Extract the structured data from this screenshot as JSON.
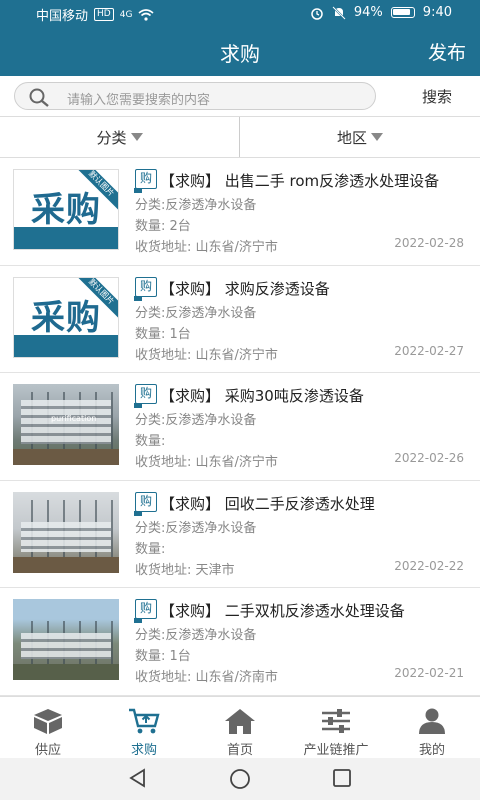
{
  "status": {
    "carrier": "中国移动",
    "hd": "HD",
    "net": "4G",
    "battery": "94%",
    "time": "9:40"
  },
  "header": {
    "title": "求购",
    "publish": "发布"
  },
  "search": {
    "placeholder": "请输入您需要搜索的内容",
    "button": "搜索"
  },
  "filters": [
    {
      "label": "分类"
    },
    {
      "label": "地区"
    }
  ],
  "thumb_text": {
    "logo_main": "采购",
    "logo_ribbon": "默认图片",
    "photo_caption": "purification"
  },
  "items": [
    {
      "tag": "购",
      "title": "【求购】 出售二手 rom反渗透水处理设备",
      "category": "分类:反渗透净水设备",
      "qty": "数量: 2台",
      "addr": "收货地址: 山东省/济宁市",
      "date": "2022-02-28"
    },
    {
      "tag": "购",
      "title": "【求购】 求购反渗透设备",
      "category": "分类:反渗透净水设备",
      "qty": "数量: 1台",
      "addr": "收货地址: 山东省/济宁市",
      "date": "2022-02-27"
    },
    {
      "tag": "购",
      "title": "【求购】 采购30吨反渗透设备",
      "category": "分类:反渗透净水设备",
      "qty": "数量:",
      "addr": "收货地址: 山东省/济宁市",
      "date": "2022-02-26"
    },
    {
      "tag": "购",
      "title": "【求购】 回收二手反渗透水处理",
      "category": "分类:反渗透净水设备",
      "qty": "数量:",
      "addr": "收货地址: 天津市",
      "date": "2022-02-22"
    },
    {
      "tag": "购",
      "title": "【求购】 二手双机反渗透水处理设备",
      "category": "分类:反渗透净水设备",
      "qty": "数量: 1台",
      "addr": "收货地址: 山东省/济南市",
      "date": "2022-02-21"
    }
  ],
  "tabs": [
    {
      "label": "供应",
      "icon": "box-icon"
    },
    {
      "label": "求购",
      "icon": "cart-icon"
    },
    {
      "label": "首页",
      "icon": "home-icon"
    },
    {
      "label": "产业链推广",
      "icon": "sliders-icon"
    },
    {
      "label": "我的",
      "icon": "user-icon"
    }
  ],
  "colors": {
    "brand": "#1f7091",
    "text": "#222222",
    "muted": "#888888"
  }
}
